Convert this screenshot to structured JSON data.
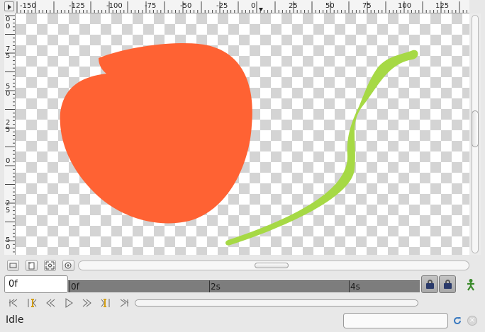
{
  "ruler": {
    "h_labels": [
      "-150",
      "-125",
      "-100",
      "-75",
      "-50",
      "-25",
      "0",
      "25",
      "50",
      "75",
      "100",
      "125"
    ],
    "v_labels": [
      "0",
      "0",
      "7",
      "5",
      "5",
      "0",
      "2",
      "5",
      "0",
      "2",
      "5",
      "5",
      "0"
    ]
  },
  "canvas": {
    "shapes": [
      {
        "name": "orange-blob",
        "color": "#ff6233"
      },
      {
        "name": "green-stroke",
        "color": "#a6d945"
      }
    ]
  },
  "timebar": {
    "current_time": "0f",
    "ticks": [
      "0f",
      "2s",
      "4s"
    ]
  },
  "status": {
    "text": "Idle",
    "field_value": ""
  },
  "colors": {
    "lock_icon": "#2a3a6a",
    "animation_mode_icon": "#3a8a2a",
    "keyframe_icon": "#d4a017"
  }
}
